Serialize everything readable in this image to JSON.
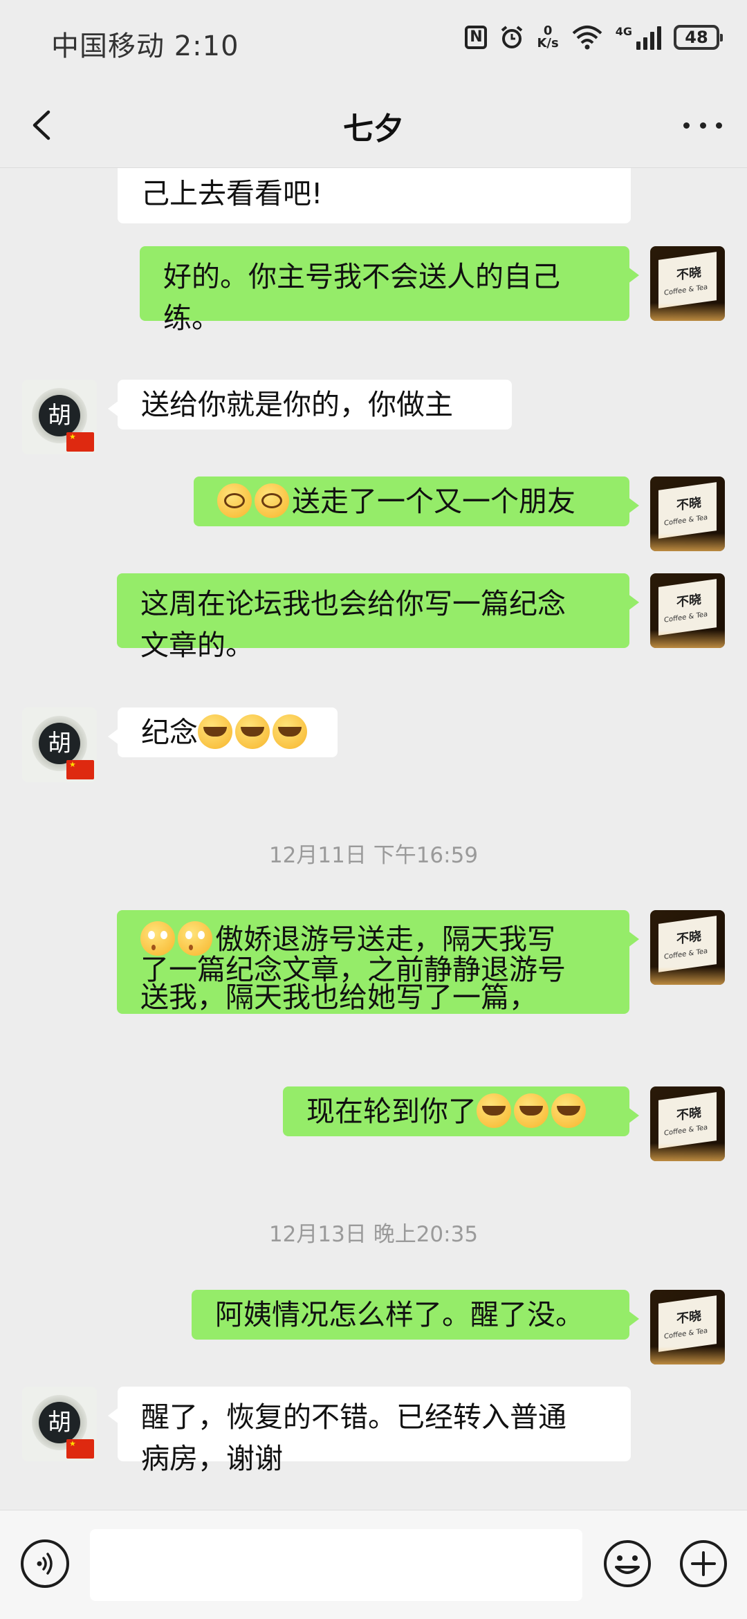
{
  "status_bar": {
    "carrier_time": "中国移动 2:10",
    "speed_value": "0",
    "speed_unit": "K/s",
    "network": "4G",
    "battery": "48"
  },
  "nav": {
    "title": "七夕"
  },
  "messages": [
    {
      "side": "in",
      "text": "己上去看看吧!"
    },
    {
      "side": "out",
      "line1": "好的。你主号我不会送人的自己",
      "line2": "练。"
    },
    {
      "side": "in",
      "text": "送给你就是你的，你做主",
      "avatar_text": "胡"
    },
    {
      "side": "out",
      "text": "送走了一个又一个朋友",
      "emoji": "grimace-emoji"
    },
    {
      "side": "out",
      "line1": "这周在论坛我也会给你写一篇纪念",
      "line2": "文章的。"
    },
    {
      "side": "in",
      "text": "纪念",
      "avatar_text": "胡",
      "emoji": "crying-emoji"
    },
    {
      "side": "out",
      "line1": "傲娇退游号送走，隔天我写",
      "line2": "了一篇纪念文章，之前静静退游号",
      "line3": "送我，隔天我也给她写了一篇，",
      "emoji": "wide-eyes-emoji"
    },
    {
      "side": "out",
      "text": "现在轮到你了",
      "emoji": "tears-of-joy-emoji"
    },
    {
      "side": "out",
      "text": "阿姨情况怎么样了。醒了没。"
    },
    {
      "side": "in",
      "line1": "醒了，恢复的不错。已经转入普通",
      "line2": "病房，谢谢",
      "avatar_text": "胡"
    }
  ],
  "timestamps": {
    "t1": "12月11日 下午16:59",
    "t2": "12月13日 晚上20:35"
  },
  "self_avatar": {
    "title": "不晓",
    "sub": "Coffee & Tea"
  },
  "colors": {
    "background": "#ededed",
    "outgoing_bubble": "#95ec69",
    "incoming_bubble": "#ffffff",
    "timestamp": "#9a9a9a"
  },
  "icons": {
    "back": "chevron-left-icon",
    "more": "more-dots-icon",
    "voice": "voice-icon",
    "emoji": "emoji-icon",
    "plus": "plus-icon"
  }
}
